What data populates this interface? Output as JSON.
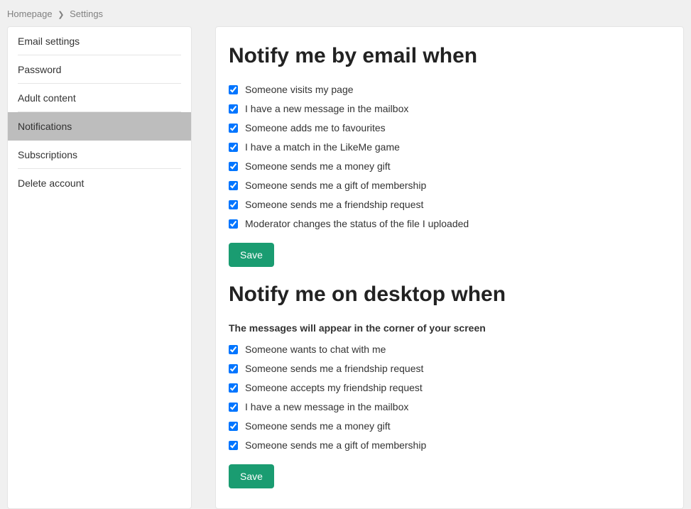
{
  "breadcrumb": {
    "items": [
      "Homepage",
      "Settings"
    ]
  },
  "sidebar": {
    "items": [
      {
        "label": "Email settings",
        "active": false
      },
      {
        "label": "Password",
        "active": false
      },
      {
        "label": "Adult content",
        "active": false
      },
      {
        "label": "Notifications",
        "active": true
      },
      {
        "label": "Subscriptions",
        "active": false
      },
      {
        "label": "Delete account",
        "active": false
      }
    ]
  },
  "main": {
    "emailSection": {
      "title": "Notify me by email when",
      "options": [
        {
          "label": "Someone visits my page",
          "checked": true
        },
        {
          "label": "I have a new message in the mailbox",
          "checked": true
        },
        {
          "label": "Someone adds me to favourites",
          "checked": true
        },
        {
          "label": "I have a match in the LikeMe game",
          "checked": true
        },
        {
          "label": "Someone sends me a money gift",
          "checked": true
        },
        {
          "label": "Someone sends me a gift of membership",
          "checked": true
        },
        {
          "label": "Someone sends me a friendship request",
          "checked": true
        },
        {
          "label": "Moderator changes the status of the file I uploaded",
          "checked": true
        }
      ],
      "saveLabel": "Save"
    },
    "desktopSection": {
      "title": "Notify me on desktop when",
      "subtitle": "The messages will appear in the corner of your screen",
      "options": [
        {
          "label": "Someone wants to chat with me",
          "checked": true
        },
        {
          "label": "Someone sends me a friendship request",
          "checked": true
        },
        {
          "label": "Someone accepts my friendship request",
          "checked": true
        },
        {
          "label": "I have a new message in the mailbox",
          "checked": true
        },
        {
          "label": "Someone sends me a money gift",
          "checked": true
        },
        {
          "label": "Someone sends me a gift of membership",
          "checked": true
        }
      ],
      "saveLabel": "Save"
    }
  }
}
